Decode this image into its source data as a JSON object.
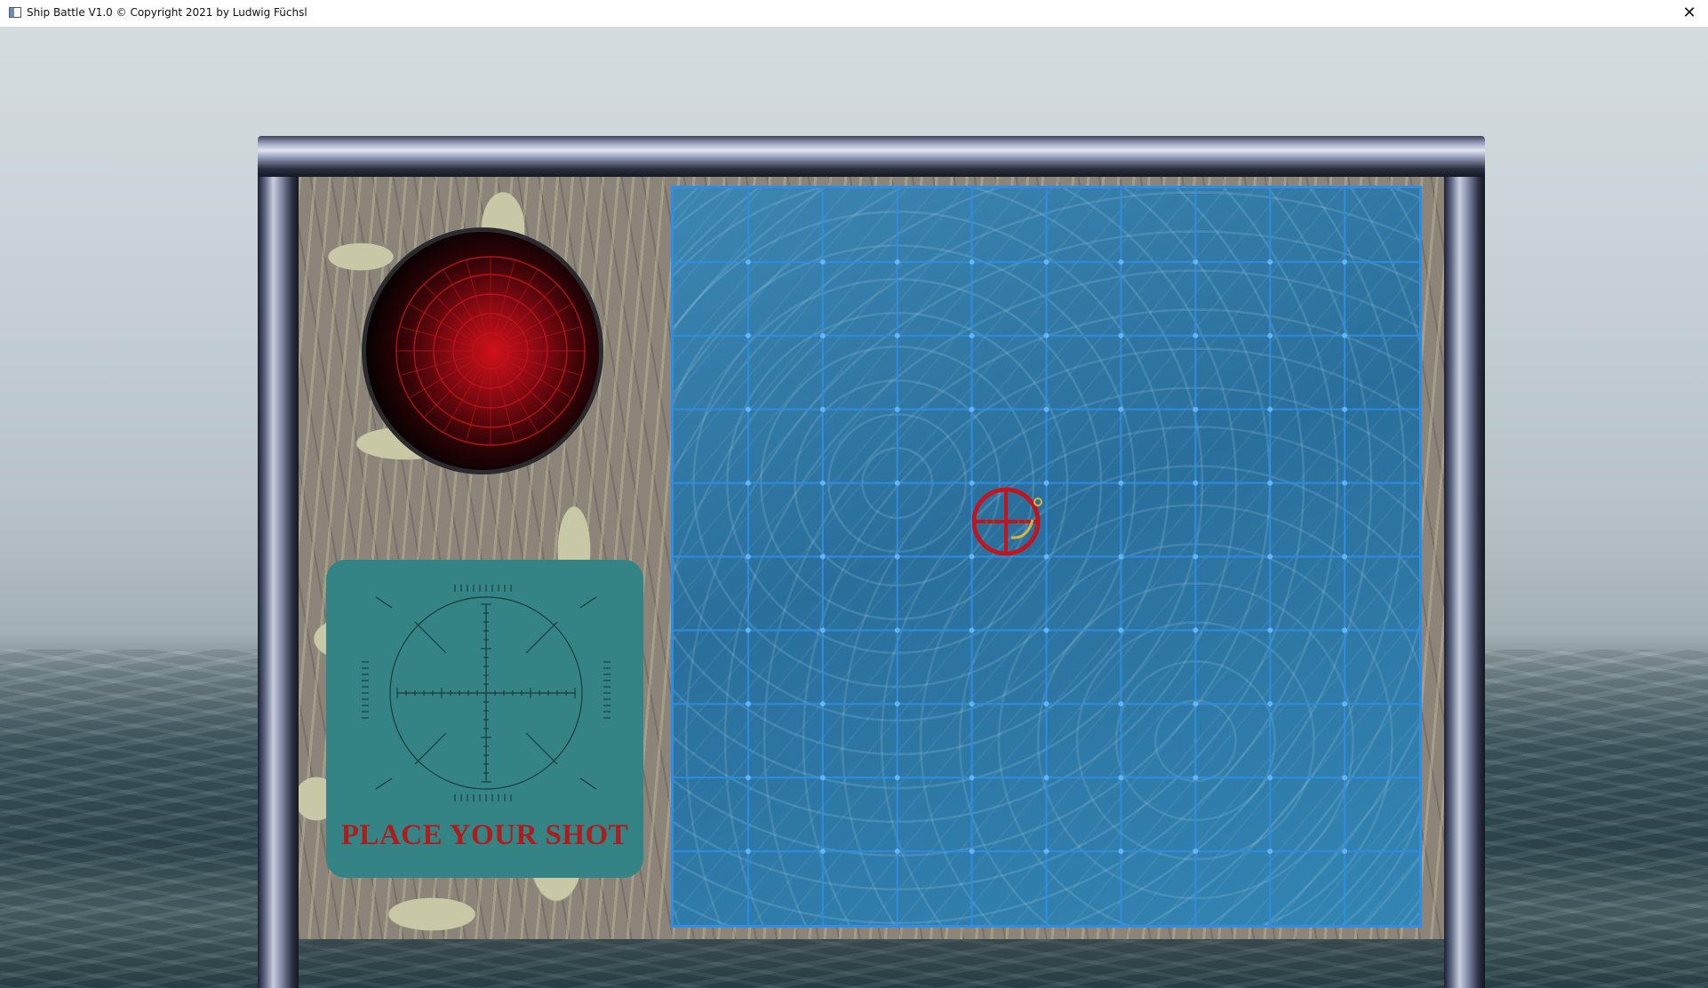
{
  "window": {
    "title": "Ship Battle V1.0 © Copyright 2021 by Ludwig Füchsl",
    "close_glyph": "✕",
    "app_icon": "window-icon"
  },
  "board": {
    "radar_icon": "radar-display-icon",
    "shot_panel": {
      "scope_icon": "scope-reticle-icon",
      "label": "PLACE YOUR SHOT"
    },
    "grid": {
      "rows": 10,
      "cols": 10,
      "target_cursor": {
        "icon": "crosshair-target-icon"
      }
    }
  },
  "colors": {
    "grid_line": "#2e8ee6",
    "shot_label": "#b01b1b",
    "shot_panel_bg": "#348486",
    "radar_red": "#c0141e"
  }
}
